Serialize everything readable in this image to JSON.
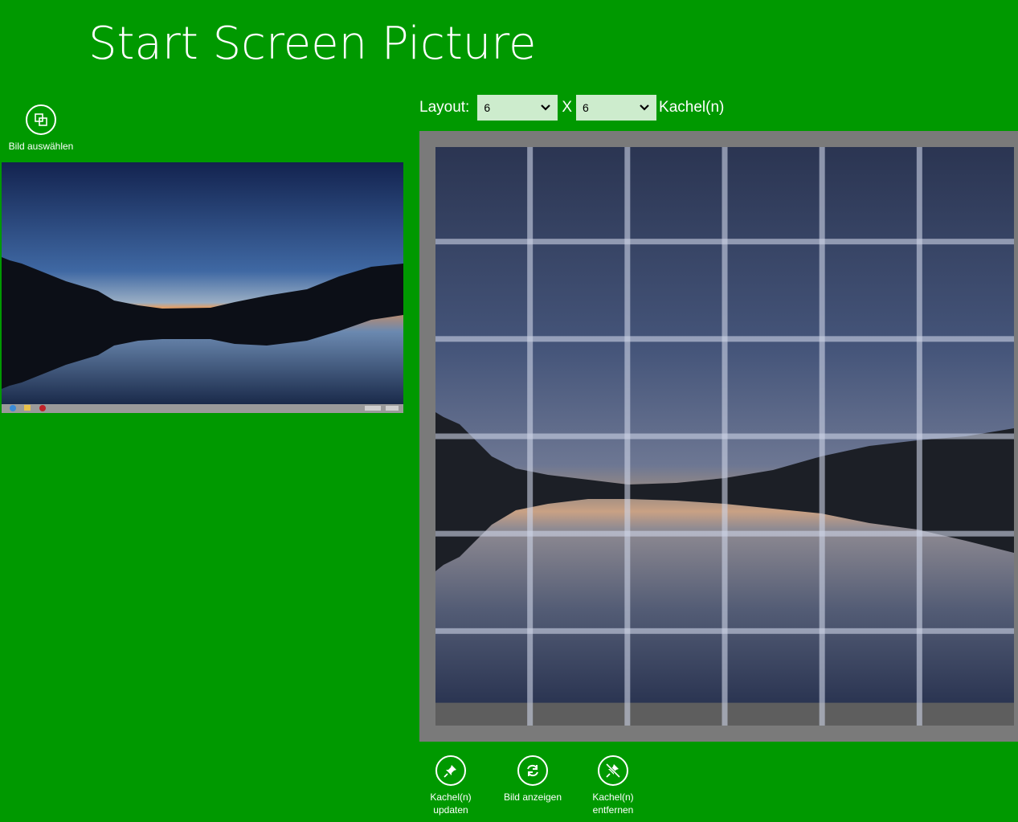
{
  "app": {
    "title": "Start Screen Picture"
  },
  "toolbar": {
    "select_image_label": "Bild auswählen"
  },
  "layout": {
    "label": "Layout:",
    "rows_value": "6",
    "separator": "X",
    "cols_value": "6",
    "unit_label": "Kachel(n)"
  },
  "actions": {
    "update_tiles_line1": "Kachel(n)",
    "update_tiles_line2": "updaten",
    "show_image_label": "Bild anzeigen",
    "remove_tiles_line1": "Kachel(n)",
    "remove_tiles_line2": "entfernen"
  },
  "grid": {
    "rows": 6,
    "cols": 6
  },
  "colors": {
    "background": "#009900",
    "select_bg": "#cdeccd",
    "frame": "#7a7a7a"
  }
}
